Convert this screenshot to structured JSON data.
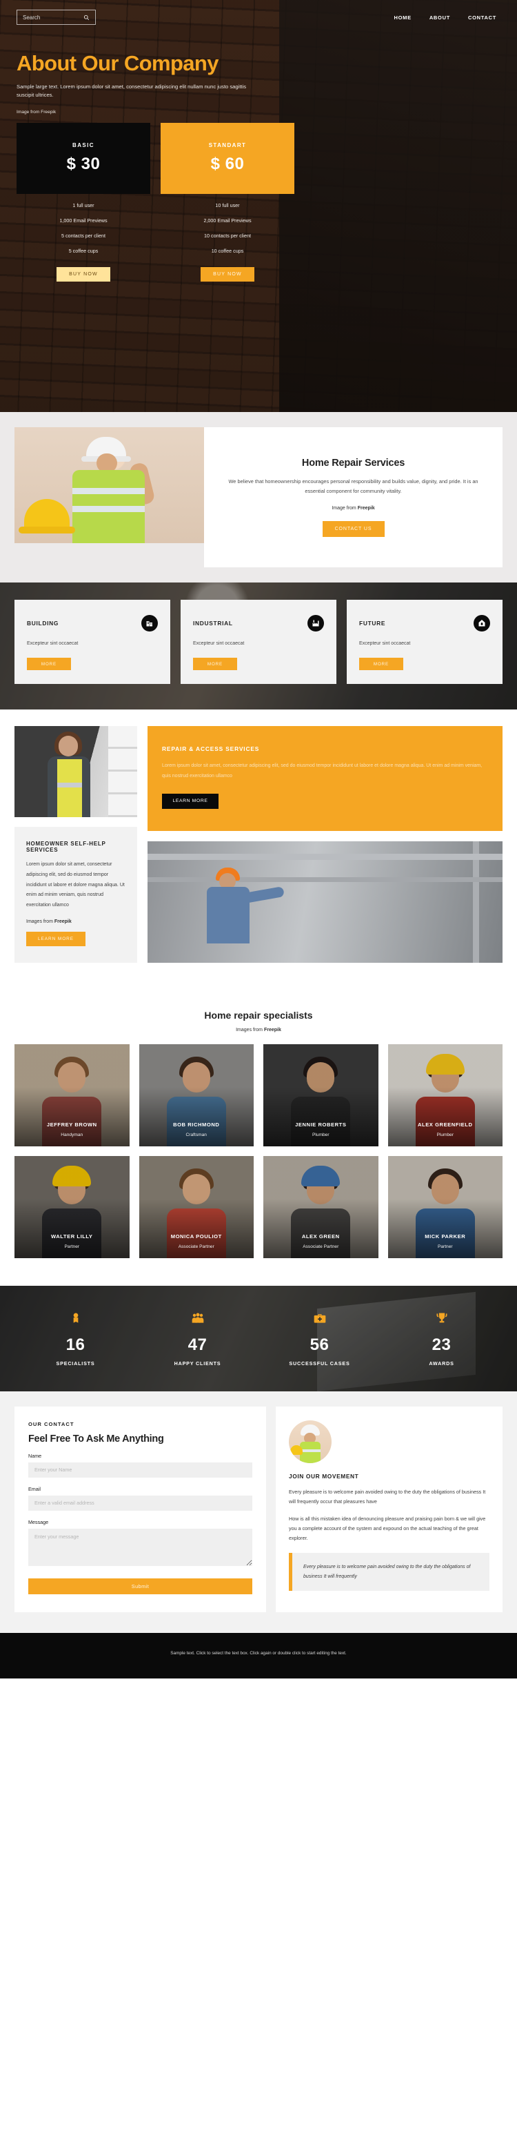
{
  "hero": {
    "search": {
      "placeholder": "Search",
      "value": "",
      "icon": "search-icon"
    },
    "nav": [
      {
        "label": "HOME"
      },
      {
        "label": "ABOUT"
      },
      {
        "label": "CONTACT"
      }
    ],
    "title": "About Our Company",
    "subtitle": "Sample large text. Lorem ipsum dolor sit amet, consectetur adipiscing elit nullam nunc justo sagittis suscipit ultrices.",
    "credit": "Image from Freepik"
  },
  "pricing": {
    "plans": [
      {
        "name": "BASIC",
        "price": "$ 30",
        "features": [
          "1 full user",
          "1,000 Email Previews",
          "5 contacts per client",
          "5 coffee cups"
        ],
        "button": "BUY NOW"
      },
      {
        "name": "STANDART",
        "price": "$ 60",
        "features": [
          "10 full user",
          "2,000 Email Previews",
          "10 contacts per client",
          "10 coffee cups"
        ],
        "button": "BUY NOW"
      }
    ]
  },
  "services": {
    "title": "Home Repair Services",
    "text": "We believe that homeownership encourages personal responsibility and builds value, dignity, and pride. It is an essential component for community vitality.",
    "credit_prefix": "Image from ",
    "credit_brand": "Freepik",
    "button": "CONTACT US"
  },
  "features": {
    "cards": [
      {
        "title": "BUILDING",
        "text": "Excepteur sint occaecat",
        "button": "MORE",
        "icon": "office-building-icon"
      },
      {
        "title": "INDUSTRIAL",
        "text": "Excepteur sint occaecat",
        "button": "MORE",
        "icon": "factory-icon"
      },
      {
        "title": "FUTURE",
        "text": "Excepteur sint occaecat",
        "button": "MORE",
        "icon": "flame-house-icon"
      }
    ]
  },
  "repair": {
    "panel": {
      "title": "REPAIR & ACCESS SERVICES",
      "text": "Lorem ipsum dolor sit amet, consectetur adipiscing elit, sed do eiusmod tempor incididunt ut labore et dolore magna aliqua. Ut enim ad minim veniam, quis nostrud exercitation ullamco",
      "button": "LEARN MORE"
    },
    "selfhelp": {
      "title": "HOMEOWNER SELF-HELP SERVICES",
      "text": "Lorem ipsum dolor sit amet, consectetur adipiscing elit, sed do eiusmod tempor incididunt ut labore et dolore magna aliqua. Ut enim ad minim veniam, quis nostrud exercitation ullamco",
      "credit_prefix": "Images from ",
      "credit_brand": "Freepik",
      "button": "LEARN MORE"
    }
  },
  "team": {
    "title": "Home repair specialists",
    "credit_prefix": "Images from ",
    "credit_brand": "Freepik",
    "members": [
      {
        "name": "JEFFREY BROWN",
        "role": "Handyman",
        "skin": "#d8a782",
        "hair": "#7b5230",
        "cloth": "#9c4a42",
        "bg": "#b9aa94"
      },
      {
        "name": "BOB RICHMOND",
        "role": "Craftsman",
        "skin": "#d7a47e",
        "hair": "#3f2a1c",
        "cloth": "#4f7fa8",
        "bg": "#8e8d8b"
      },
      {
        "name": "JENNIE ROBERTS",
        "role": "Plumber",
        "skin": "#c99a72",
        "hair": "#1d1614",
        "cloth": "#2a2a2a",
        "bg": "#3a3a3a"
      },
      {
        "name": "ALEX GREENFIELD",
        "role": "Plumber",
        "skin": "#d6a179",
        "hair": "#3a2718",
        "cloth": "#b5372c",
        "bg": "#dedad3",
        "helmet": "#f5c518"
      },
      {
        "name": "WALTER LILLY",
        "role": "Partner",
        "skin": "#d3a079",
        "hair": "#42301f",
        "cloth": "#2f2f33",
        "bg": "#6f6a63",
        "helmet": "#f2c300"
      },
      {
        "name": "MONICA POULIOT",
        "role": "Associate Partner",
        "skin": "#dcab83",
        "hair": "#6a4526",
        "cloth": "#cf4b3a",
        "bg": "#8b8376"
      },
      {
        "name": "ALEX GREEN",
        "role": "Associate Partner",
        "skin": "#cf9c74",
        "hair": "#2b1d14",
        "cloth": "#4c4a48",
        "bg": "#b5ada1",
        "helmet": "#3e6fa8"
      },
      {
        "name": "MICK PARKER",
        "role": "Partner",
        "skin": "#d4a078",
        "hair": "#33231a",
        "cloth": "#3c6da3",
        "bg": "#c8c2b7"
      }
    ]
  },
  "stats": {
    "items": [
      {
        "value": "16",
        "label": "SPECIALISTS",
        "icon": "person-badge-icon"
      },
      {
        "value": "47",
        "label": "HAPPY CLIENTS",
        "icon": "people-group-icon"
      },
      {
        "value": "56",
        "label": "SUCCESSFUL CASES",
        "icon": "briefcase-icon"
      },
      {
        "value": "23",
        "label": "AWARDS",
        "icon": "trophy-icon"
      }
    ]
  },
  "contact": {
    "eyebrow": "OUR CONTACT",
    "title": "Feel Free To Ask Me Anything",
    "fields": {
      "name": {
        "label": "Name",
        "placeholder": "Enter your Name",
        "value": ""
      },
      "email": {
        "label": "Email",
        "placeholder": "Enter a valid email address",
        "value": ""
      },
      "message": {
        "label": "Message",
        "placeholder": "Enter your message",
        "value": ""
      }
    },
    "submit": "Submit",
    "side": {
      "title": "JOIN OUR MOVEMENT",
      "paragraph1": "Every pleasure is to welcome pain avoided owing to the duty the obligations of business It will frequently occur that pleasures have",
      "paragraph2": "How is all this mistaken idea of denouncing pleasure and praising pain born & we will give you a complete account of the system and expound on the actual teaching of the great explorer.",
      "quote": "Every pleasure is to welcome pain avoided owing to the duty the obligations of business It will frequently"
    }
  },
  "footer": {
    "text": "Sample text. Click to select the text box. Click again or double click to start editing the text."
  },
  "colors": {
    "accent": "#f5a623",
    "dark": "#0a0a0a",
    "light_gray": "#f2f2f2"
  }
}
